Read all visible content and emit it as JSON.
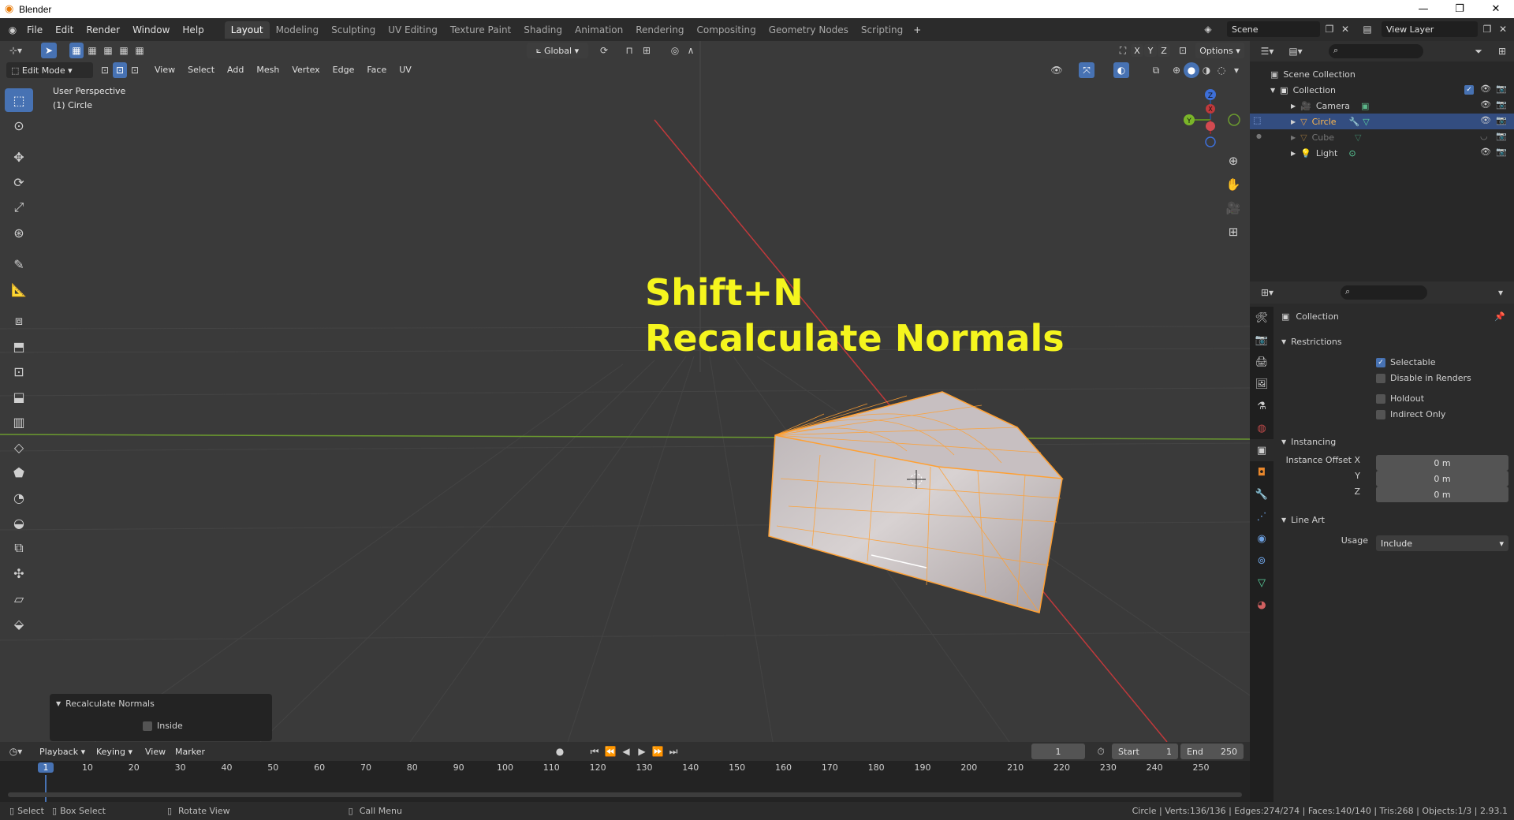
{
  "window": {
    "title": "Blender"
  },
  "menu": [
    "File",
    "Edit",
    "Render",
    "Window",
    "Help"
  ],
  "workspaces": [
    {
      "label": "Layout",
      "active": true
    },
    {
      "label": "Modeling"
    },
    {
      "label": "Sculpting"
    },
    {
      "label": "UV Editing"
    },
    {
      "label": "Texture Paint"
    },
    {
      "label": "Shading"
    },
    {
      "label": "Animation"
    },
    {
      "label": "Rendering"
    },
    {
      "label": "Compositing"
    },
    {
      "label": "Geometry Nodes"
    },
    {
      "label": "Scripting"
    }
  ],
  "scene": {
    "name": "Scene",
    "view_layer": "View Layer"
  },
  "viewport_header": {
    "transform_orientation": "Global",
    "options": "Options",
    "mode": "Edit Mode",
    "menus": [
      "View",
      "Select",
      "Add",
      "Mesh",
      "Vertex",
      "Edge",
      "Face",
      "UV"
    ],
    "axes": [
      "X",
      "Y",
      "Z"
    ]
  },
  "viewport": {
    "perspective": "User Perspective",
    "object": "(1) Circle",
    "overlay_line1": "Shift+N",
    "overlay_line2": "Recalculate Normals",
    "gizmo_axes": [
      "Z",
      "Y",
      "X"
    ]
  },
  "operator_panel": {
    "title": "Recalculate Normals",
    "option": "Inside",
    "checked": false
  },
  "outliner": {
    "root": "Scene Collection",
    "collection": "Collection",
    "items": [
      {
        "name": "Camera",
        "selected": false
      },
      {
        "name": "Circle",
        "selected": true
      },
      {
        "name": "Cube",
        "selected": false,
        "hidden": true
      },
      {
        "name": "Light",
        "selected": false
      }
    ]
  },
  "properties": {
    "header": "Collection",
    "restrictions": {
      "title": "Restrictions",
      "selectable": "Selectable",
      "disable_renders": "Disable in Renders",
      "holdout": "Holdout",
      "indirect_only": "Indirect Only"
    },
    "instancing": {
      "title": "Instancing",
      "offset_label": "Instance Offset X",
      "y_label": "Y",
      "z_label": "Z",
      "x": "0 m",
      "y": "0 m",
      "z": "0 m"
    },
    "line_art": {
      "title": "Line Art",
      "usage_label": "Usage",
      "usage_value": "Include"
    }
  },
  "timeline": {
    "menus": [
      "Playback",
      "Keying",
      "View",
      "Marker"
    ],
    "current_frame": "1",
    "start_label": "Start",
    "start": "1",
    "end_label": "End",
    "end": "250",
    "ticks": [
      "1",
      "10",
      "20",
      "30",
      "40",
      "50",
      "60",
      "70",
      "80",
      "90",
      "100",
      "110",
      "120",
      "130",
      "140",
      "150",
      "160",
      "170",
      "180",
      "190",
      "200",
      "210",
      "220",
      "230",
      "240",
      "250"
    ]
  },
  "statusbar": {
    "select": "Select",
    "box_select": "Box Select",
    "rotate": "Rotate View",
    "call_menu": "Call Menu",
    "stats": "Circle | Verts:136/136 | Edges:274/274 | Faces:140/140 | Tris:268 | Objects:1/3 | 2.93.1"
  },
  "colors": {
    "accent": "#4772b3",
    "selection_edge": "#ffa033",
    "overlay_text": "#f5f51e",
    "x_axis": "#c0393b",
    "y_axis": "#6b9a2f"
  }
}
